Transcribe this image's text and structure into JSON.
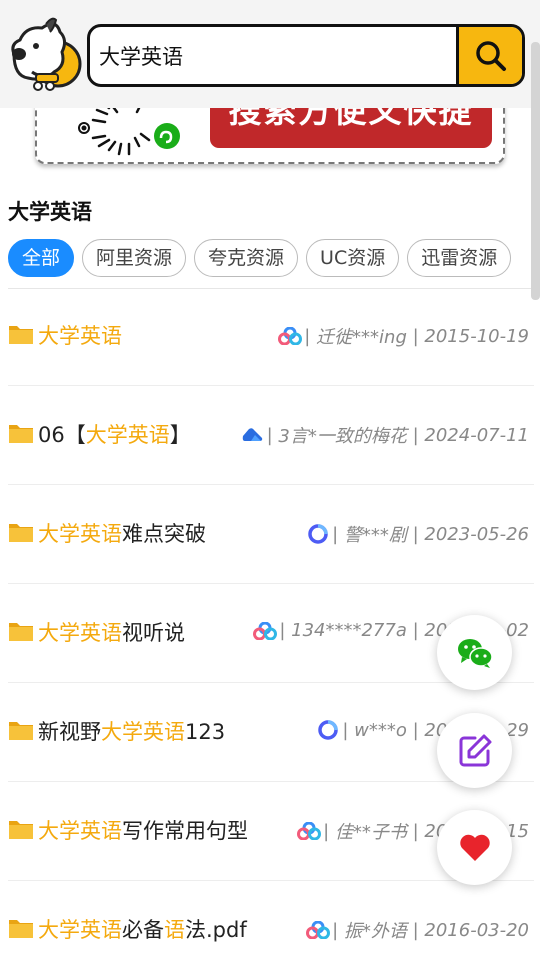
{
  "search": {
    "value": "大学英语"
  },
  "banner": {
    "text": "搜索方便又快捷"
  },
  "page_title": "大学英语",
  "filters": [
    "全部",
    "阿里资源",
    "夸克资源",
    "UC资源",
    "迅雷资源"
  ],
  "results": [
    {
      "parts": [
        {
          "t": "大学英语",
          "h": true
        }
      ],
      "source": "baidu",
      "user": "迁徙***ing",
      "date": "2015-10-19"
    },
    {
      "parts": [
        {
          "t": "06【",
          "h": false
        },
        {
          "t": "大学英语",
          "h": true
        },
        {
          "t": "】",
          "h": false
        }
      ],
      "source": "aliyun",
      "user": "3言*一致的梅花",
      "date": "2024-07-11"
    },
    {
      "parts": [
        {
          "t": "大学英语",
          "h": true
        },
        {
          "t": "难点突破",
          "h": false
        }
      ],
      "source": "quark",
      "user": "警***剧",
      "date": "2023-05-26"
    },
    {
      "parts": [
        {
          "t": "大学英语",
          "h": true
        },
        {
          "t": "视听说",
          "h": false
        }
      ],
      "source": "baidu",
      "user": "134****277a",
      "date": "2014-12-02"
    },
    {
      "parts": [
        {
          "t": "新视野",
          "h": false
        },
        {
          "t": "大学英语",
          "h": true
        },
        {
          "t": "123",
          "h": false
        }
      ],
      "source": "quark",
      "user": "w***o",
      "date": "2023-01-29"
    },
    {
      "parts": [
        {
          "t": "大学英语",
          "h": true
        },
        {
          "t": "写作常用句型",
          "h": false
        }
      ],
      "source": "baidu",
      "user": "佳**子书",
      "date": "2017-12-15"
    },
    {
      "parts": [
        {
          "t": "大学英语",
          "h": true
        },
        {
          "t": "必备",
          "h": false
        },
        {
          "t": "语",
          "h": true
        },
        {
          "t": "法.pdf",
          "h": false
        }
      ],
      "source": "baidu",
      "user": "振*外语",
      "date": "2016-03-20"
    }
  ],
  "icons": {
    "search": "search-icon",
    "wechat": "wechat-icon",
    "edit": "edit-icon",
    "favorite": "heart-icon",
    "folder": "folder-icon"
  },
  "colors": {
    "accent": "#f7b70f",
    "highlight": "#f4a90e",
    "active_chip": "#1a8cff",
    "banner_red": "#c0282a",
    "heart": "#e8242c"
  }
}
